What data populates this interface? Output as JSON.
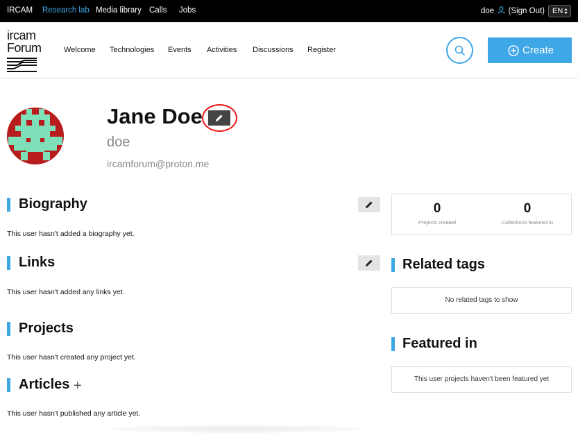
{
  "topbar": {
    "links": [
      {
        "label": "IRCAM",
        "active": false
      },
      {
        "label": "Research lab",
        "active": true
      },
      {
        "label": "Media library",
        "active": false
      },
      {
        "label": "Calls",
        "active": false
      },
      {
        "label": "Jobs",
        "active": false
      }
    ],
    "user": "doe",
    "sign_out": "(Sign Out)",
    "language": "EN"
  },
  "header": {
    "logo_line1": "ircam",
    "logo_line2": "Forum",
    "nav": [
      "Welcome",
      "Technologies",
      "Events",
      "Activities",
      "Discussions",
      "Register"
    ],
    "search_icon": "search-icon",
    "create_label": "Create"
  },
  "profile": {
    "full_name": "Jane Doe",
    "username": "doe",
    "email": "ircamforum@proton.me",
    "edit_icon": "pencil-icon"
  },
  "sections": {
    "biography": {
      "title": "Biography",
      "text": "This user hasn't added a biography yet."
    },
    "links": {
      "title": "Links",
      "text": "This user hasn't added any links yet."
    },
    "projects": {
      "title": "Projects",
      "text": "This user hasn't created any project yet."
    },
    "articles": {
      "title": "Articles",
      "add": "+",
      "text": "This user hasn't published any article yet."
    }
  },
  "stats": {
    "projects_created": {
      "value": "0",
      "label": "Projects created"
    },
    "collections_featured": {
      "value": "0",
      "label": "Collections featured in"
    }
  },
  "related_tags": {
    "title": "Related tags",
    "empty": "No related tags to show"
  },
  "featured_in": {
    "title": "Featured in",
    "empty": "This user projects haven't been featured yet"
  },
  "colors": {
    "accent": "#3ea7e6",
    "avatar_bg": "#b81c1c",
    "avatar_fg": "#7ee0b8",
    "highlight": "#ee1111"
  }
}
